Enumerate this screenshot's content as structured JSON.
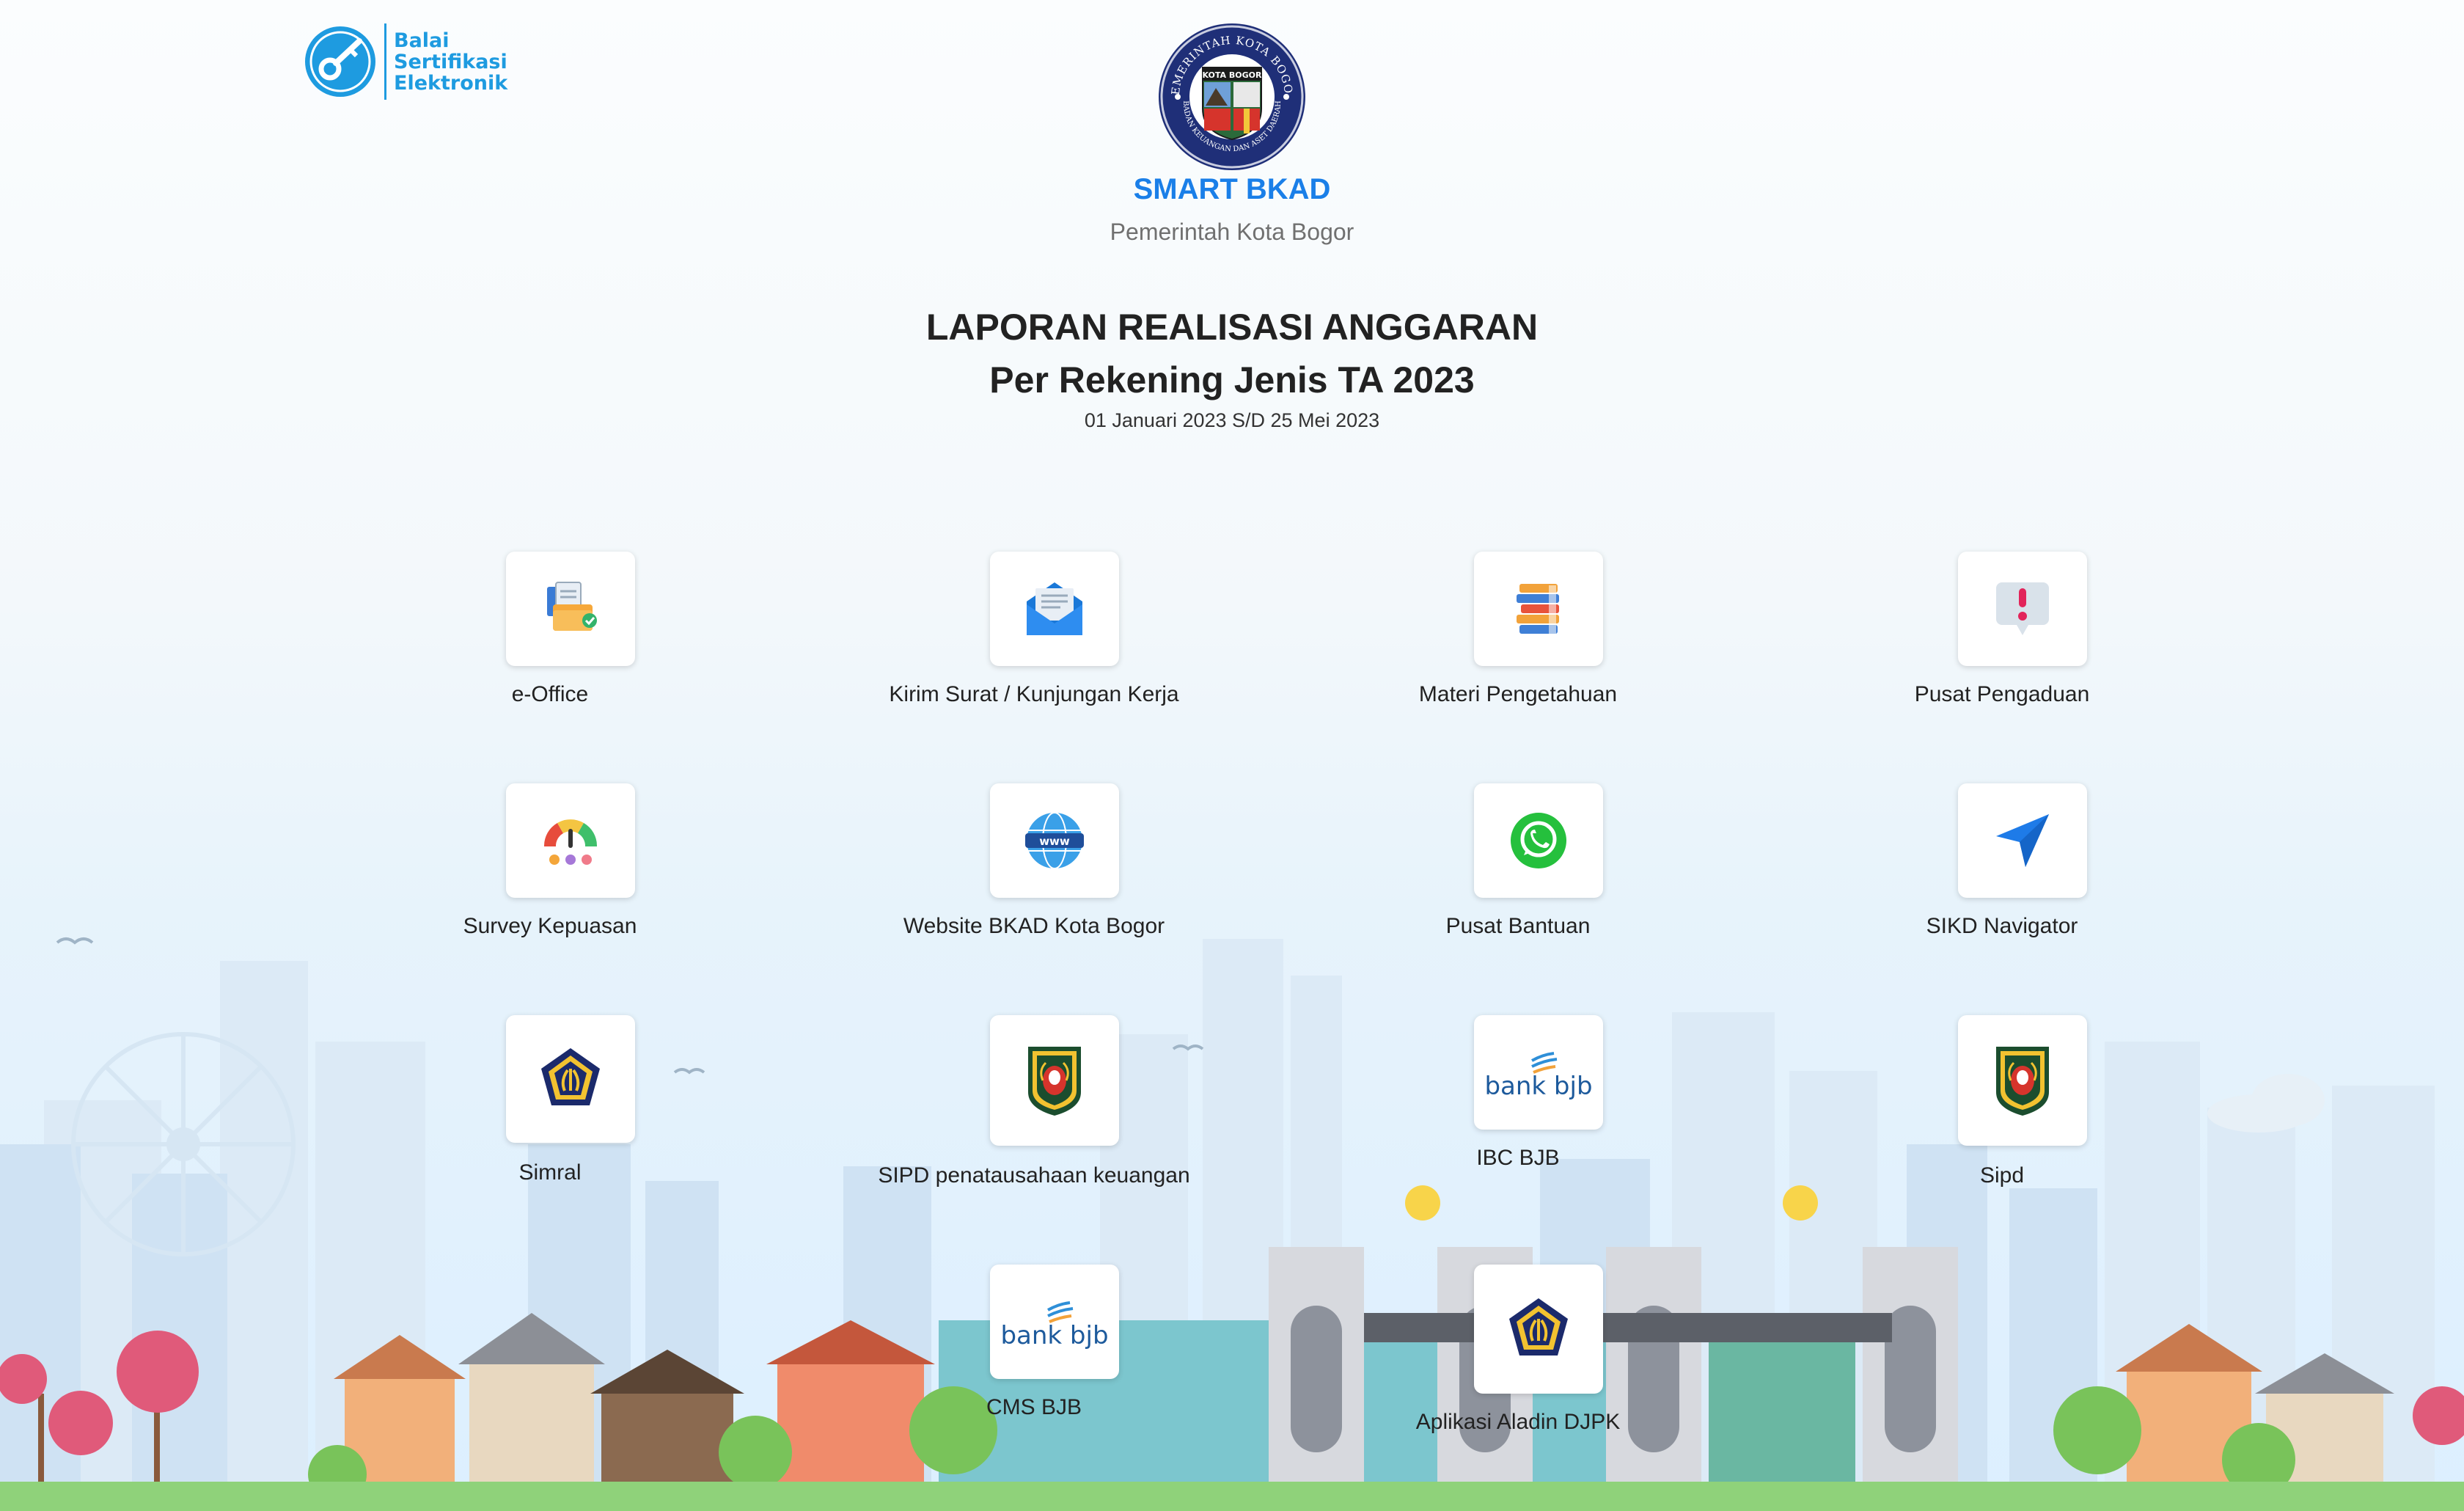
{
  "header": {
    "bse_logo": {
      "lines": [
        "Balai",
        "Sertifikasi",
        "Elektronik"
      ],
      "icon": "key-badge-icon"
    },
    "seal": {
      "icon": "kota-bogor-seal",
      "ring_text": "PEMERINTAH KOTA BOGOR",
      "inner_label": "KOTA BOGOR",
      "bottom_text": "BADAN KEUANGAN DAN ASET DAERAH"
    },
    "brand_title": "SMART BKAD",
    "brand_subtitle": "Pemerintah Kota Bogor"
  },
  "report": {
    "title_line1": "LAPORAN REALISASI ANGGARAN",
    "title_line2": "Per Rekening Jenis TA 2023",
    "period": "01 Januari 2023 S/D 25 Mei 2023"
  },
  "apps": [
    {
      "label": "e-Office",
      "icon": "document-folder-icon"
    },
    {
      "label": "Kirim Surat / Kunjungan Kerja",
      "icon": "envelope-icon"
    },
    {
      "label": "Materi Pengetahuan",
      "icon": "books-icon"
    },
    {
      "label": "Pusat Pengaduan",
      "icon": "exclamation-chat-icon"
    },
    {
      "label": "Survey Kepuasan",
      "icon": "gauge-icon"
    },
    {
      "label": "Website BKAD Kota Bogor",
      "icon": "globe-www-icon"
    },
    {
      "label": "Pusat Bantuan",
      "icon": "whatsapp-icon"
    },
    {
      "label": "SIKD Navigator",
      "icon": "navigation-arrow-icon"
    },
    {
      "label": "Simral",
      "icon": "kemenkeu-logo-icon"
    },
    {
      "label": "SIPD penatausahaan keuangan",
      "icon": "kemendagri-logo-icon"
    },
    {
      "label": "IBC BJB",
      "icon": "bank-bjb-logo-icon",
      "logo_text": "bank bjb"
    },
    {
      "label": "Sipd",
      "icon": "kemendagri-logo-icon"
    },
    {
      "label": "CMS BJB",
      "icon": "bank-bjb-logo-icon",
      "logo_text": "bank bjb"
    },
    {
      "label": "Aplikasi Aladin DJPK",
      "icon": "kemenkeu-logo-icon"
    }
  ],
  "colors": {
    "brand_blue": "#1a7fe8",
    "bse_blue": "#1e9be0",
    "whatsapp_green": "#25c03d",
    "bjb_blue": "#1d5a9c"
  }
}
